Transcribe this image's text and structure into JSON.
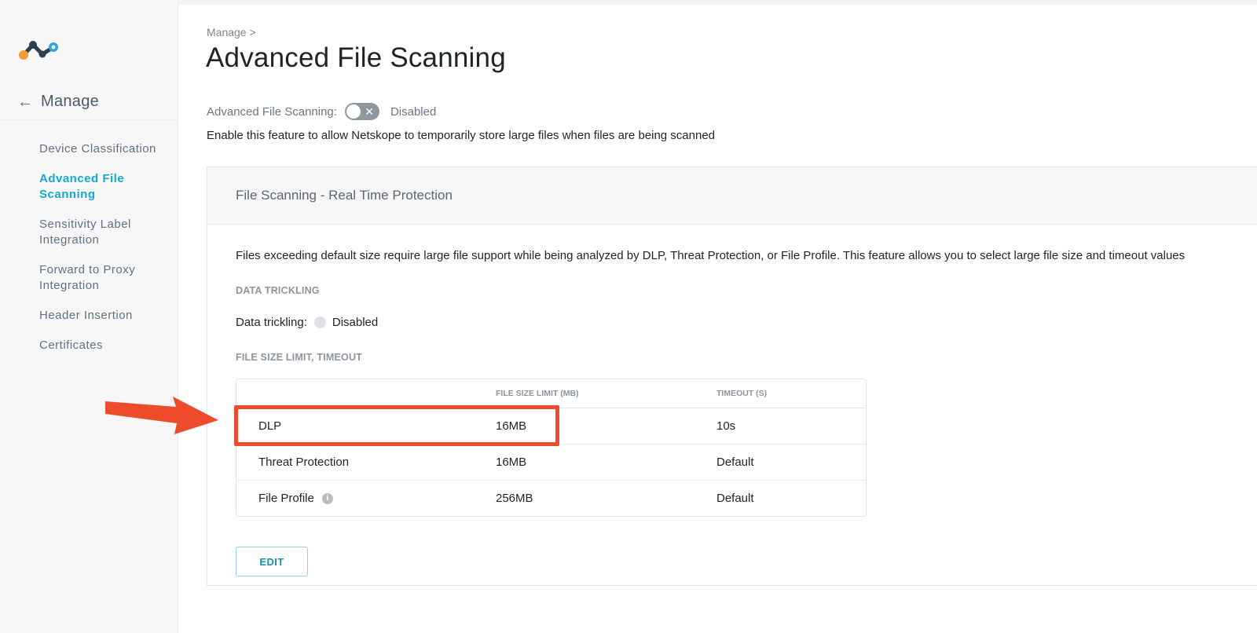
{
  "sidebar": {
    "back_arrow": "←",
    "title": "Manage",
    "items": [
      {
        "label": "Device Classification"
      },
      {
        "label": "Advanced File Scanning"
      },
      {
        "label": "Sensitivity Label Integration"
      },
      {
        "label": "Forward to Proxy Integration"
      },
      {
        "label": "Header Insertion"
      },
      {
        "label": "Certificates"
      }
    ],
    "active_index": 1
  },
  "breadcrumb": "Manage >",
  "page_title": "Advanced File Scanning",
  "feature": {
    "label": "Advanced File Scanning:",
    "toggle_icon": "✕",
    "status": "Disabled",
    "description": "Enable this feature to allow Netskope to temporarily store large files when files are being scanned"
  },
  "card": {
    "title": "File Scanning - Real Time Protection",
    "description": "Files exceeding default size require large file support while being analyzed by DLP, Threat Protection, or File Profile. This feature allows you to select large file size and timeout values",
    "data_trickling": {
      "section": "DATA TRICKLING",
      "label": "Data trickling:",
      "status": "Disabled"
    },
    "limits": {
      "section": "FILE SIZE LIMIT, TIMEOUT",
      "headers": [
        "",
        "FILE SIZE LIMIT (MB)",
        "TIMEOUT (S)"
      ],
      "rows": [
        {
          "name": "DLP",
          "size": "16MB",
          "timeout": "10s"
        },
        {
          "name": "Threat Protection",
          "size": "16MB",
          "timeout": "Default"
        },
        {
          "name": "File Profile",
          "size": "256MB",
          "timeout": "Default"
        }
      ],
      "info_icon": "i"
    },
    "edit_label": "EDIT"
  },
  "colors": {
    "accent": "#16a9cf",
    "annotation": "#ee4b2b"
  }
}
